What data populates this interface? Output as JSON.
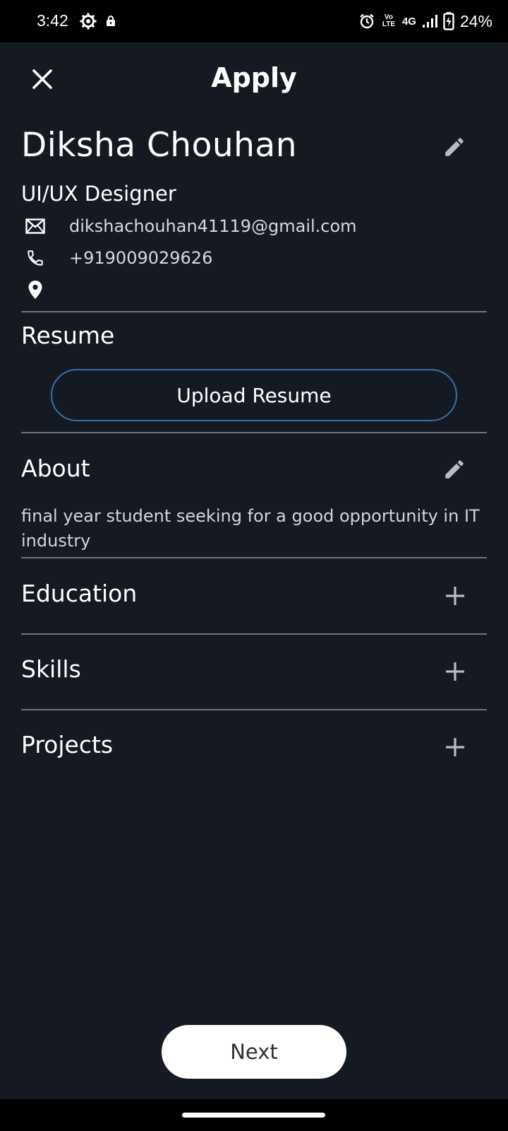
{
  "status_bar": {
    "time": "3:42",
    "network": "4G",
    "volte": "Vo LTE",
    "battery": "24%"
  },
  "header": {
    "title": "Apply",
    "close_icon": "close-icon"
  },
  "profile": {
    "name": "Diksha Chouhan",
    "role": "UI/UX Designer",
    "email": "dikshachouhan41119@gmail.com",
    "phone": "+919009029626",
    "location": ""
  },
  "resume": {
    "label": "Resume",
    "upload_label": "Upload Resume"
  },
  "about": {
    "label": "About",
    "text": "final year student seeking for a good opportunity in IT industry"
  },
  "sections": [
    {
      "label": "Education",
      "icon": "plus-icon"
    },
    {
      "label": "Skills",
      "icon": "plus-icon"
    },
    {
      "label": "Projects",
      "icon": "plus-icon"
    }
  ],
  "footer": {
    "next_label": "Next"
  },
  "colors": {
    "background": "#151a22",
    "accent_border": "#3b6fa6",
    "divider": "#6d7480",
    "button_bg": "#ffffff"
  }
}
